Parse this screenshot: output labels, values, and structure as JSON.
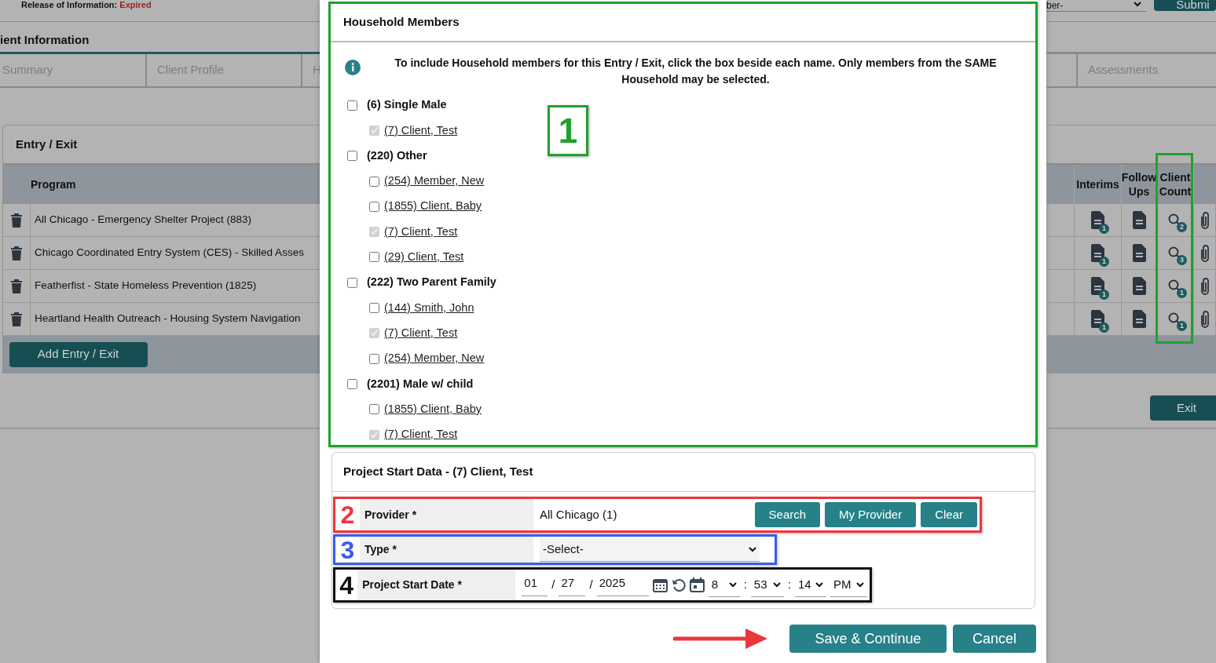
{
  "top_strip": {
    "release_label": "Release of Information:",
    "release_status": "Expired",
    "member_select": "ber-",
    "submit_button": "Submi"
  },
  "section_title": "ient Information",
  "tabs_left": [
    {
      "label": "Summary"
    },
    {
      "label": "Client Profile"
    },
    {
      "label": "H"
    }
  ],
  "tabs_right": [
    {
      "label": "Assessments"
    }
  ],
  "entry_exit": {
    "title": "Entry / Exit",
    "columns_left": [
      {
        "label": "Program"
      }
    ],
    "columns_right": [
      {
        "label": "Interims",
        "highlighted": false
      },
      {
        "label": "Follow Ups",
        "highlighted": false
      },
      {
        "label": "Client Count",
        "highlighted": true
      }
    ],
    "rows": [
      {
        "program": "All Chicago - Emergency Shelter Project (883)",
        "interims_count": "1",
        "client_count": "2"
      },
      {
        "program": "Chicago Coordinated Entry System (CES) - Skilled Asses",
        "interims_count": "1",
        "client_count": "3"
      },
      {
        "program": "Featherfist - State Homeless Prevention (1825)",
        "interims_count": "1",
        "client_count": "1"
      },
      {
        "program": "Heartland Health Outreach - Housing System Navigation",
        "interims_count": "1",
        "client_count": "1"
      }
    ],
    "add_button": "Add Entry / Exit",
    "exit_button": "Exit"
  },
  "household": {
    "title": "Household Members",
    "annotation": {
      "label": "1",
      "color": "#1fa22e"
    },
    "info": "To include Household members for this Entry / Exit, click the box beside each name. Only members from the SAME Household may be selected.",
    "groups": [
      {
        "label": "(6) Single Male",
        "checked": false,
        "children": [
          {
            "label": "(7) Client, Test",
            "checked": true,
            "disabled": true
          }
        ]
      },
      {
        "label": "(220) Other",
        "checked": false,
        "children": [
          {
            "label": "(254) Member, New",
            "checked": false,
            "disabled": false
          },
          {
            "label": "(1855) Client, Baby",
            "checked": false,
            "disabled": false
          },
          {
            "label": "(7) Client, Test",
            "checked": true,
            "disabled": true
          },
          {
            "label": "(29) Client, Test",
            "checked": false,
            "disabled": false
          }
        ]
      },
      {
        "label": "(222) Two Parent Family",
        "checked": false,
        "children": [
          {
            "label": "(144) Smith, John",
            "checked": false,
            "disabled": false
          },
          {
            "label": "(7) Client, Test",
            "checked": true,
            "disabled": true
          },
          {
            "label": "(254) Member, New",
            "checked": false,
            "disabled": false
          }
        ]
      },
      {
        "label": "(2201) Male w/ child",
        "checked": false,
        "children": [
          {
            "label": "(1855) Client, Baby",
            "checked": false,
            "disabled": false
          },
          {
            "label": "(7) Client, Test",
            "checked": true,
            "disabled": true
          }
        ]
      }
    ]
  },
  "project_start": {
    "title": "Project Start Data - (7) Client, Test",
    "fields": [
      {
        "kind": "provider",
        "label": "Provider *",
        "annotation": "2",
        "color": "#f0353a",
        "value": "All Chicago (1)",
        "buttons": [
          "Search",
          "My Provider",
          "Clear"
        ]
      },
      {
        "kind": "select",
        "label": "Type *",
        "annotation": "3",
        "color": "#3c5af0",
        "value": "-Select-"
      },
      {
        "kind": "datetime",
        "label": "Project Start Date *",
        "annotation": "4",
        "color": "#111111",
        "month": "01",
        "day": "27",
        "year": "2025",
        "date_separator": "/",
        "hour": "8",
        "minute": "53",
        "second": "14",
        "time_separator": ":",
        "ampm": "PM"
      }
    ]
  },
  "footer_buttons": [
    {
      "label": "Save & Continue"
    },
    {
      "label": "Cancel"
    }
  ]
}
